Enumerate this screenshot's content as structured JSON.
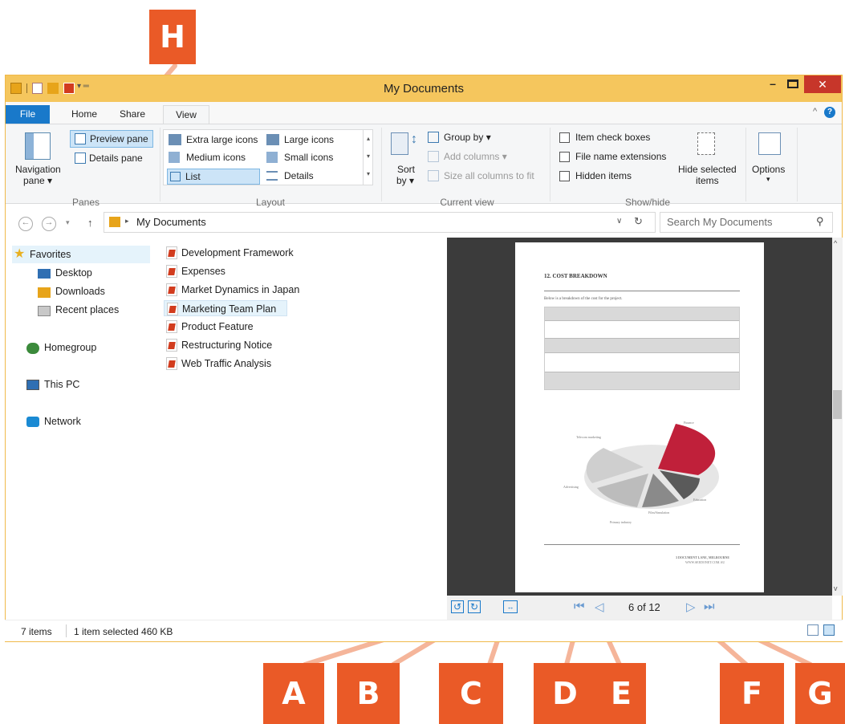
{
  "window": {
    "title": "My Documents"
  },
  "ribbon_tabs": [
    "File",
    "Home",
    "Share",
    "View"
  ],
  "ribbon": {
    "panes": {
      "navigation_pane": "Navigation",
      "navigation_pane2": "pane ▾",
      "preview_pane": "Preview pane",
      "details_pane": "Details pane",
      "group": "Panes"
    },
    "layout": {
      "extra_large": "Extra large icons",
      "large": "Large icons",
      "medium": "Medium icons",
      "small": "Small icons",
      "list": "List",
      "details": "Details",
      "group": "Layout"
    },
    "current_view": {
      "sort_by": "Sort",
      "sort_by2": "by ▾",
      "group_by": "Group by ▾",
      "add_columns": "Add columns ▾",
      "size_all": "Size all columns to fit",
      "group": "Current view"
    },
    "show_hide": {
      "item_check": "Item check boxes",
      "file_ext": "File name extensions",
      "hidden": "Hidden items",
      "hide_selected": "Hide selected",
      "hide_selected2": "items",
      "group": "Show/hide"
    },
    "options": "Options"
  },
  "address": {
    "path": "My Documents",
    "search_placeholder": "Search My Documents"
  },
  "nav": {
    "favorites": "Favorites",
    "favorites_items": [
      "Desktop",
      "Downloads",
      "Recent places"
    ],
    "homegroup": "Homegroup",
    "this_pc": "This PC",
    "network": "Network"
  },
  "files": [
    "Development Framework",
    "Expenses",
    "Market Dynamics in Japan",
    "Marketing Team Plan",
    "Product Feature",
    "Restructuring Notice",
    "Web Traffic Analysis"
  ],
  "selected_file": "Marketing Team Plan",
  "preview": {
    "heading": "12.   COST BREAKDOWN",
    "intro": "Below is a breakdown of the cost for the project.",
    "page_counter": "6 of 12",
    "footer_line1": "3 DOCUMENT LANE, MELBOURNE",
    "footer_line2": "WWW.SEEDONET.COM.AU",
    "pie_labels": [
      "Finance",
      "Telecom marketing",
      "Advertising",
      "Education",
      "Film/Simulation",
      "Primary industry"
    ]
  },
  "status": {
    "items": "7 items",
    "selected": "1 item selected  460 KB"
  },
  "callouts": [
    "A",
    "B",
    "C",
    "D",
    "E",
    "F",
    "G",
    "H"
  ],
  "colors": {
    "titlebar": "#f5c65d",
    "accent": "#1979ca",
    "callout": "#ea5a27",
    "close": "#c7362a"
  }
}
